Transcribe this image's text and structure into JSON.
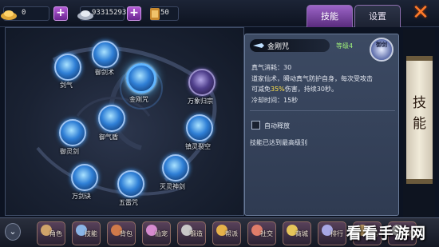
{
  "topbar": {
    "gold_value": "0",
    "silver_value": "933152938",
    "scroll_value": "50"
  },
  "tabs": [
    {
      "label": "技能",
      "active": true
    },
    {
      "label": "设置",
      "active": false
    }
  ],
  "skill_tree": {
    "nodes": [
      {
        "label": "剑气",
        "style": "blue"
      },
      {
        "label": "御剑术",
        "style": "blue"
      },
      {
        "label": "金刚咒",
        "style": "blue",
        "selected": true
      },
      {
        "label": "万象归宗",
        "style": "purple"
      },
      {
        "label": "御气盾",
        "style": "blue"
      },
      {
        "label": "御灵剑",
        "style": "blue"
      },
      {
        "label": "镇灵裂空",
        "style": "blue"
      },
      {
        "label": "灭灵神剑",
        "style": "blue"
      },
      {
        "label": "万剑诀",
        "style": "blue"
      },
      {
        "label": "五雷咒",
        "style": "blue"
      }
    ]
  },
  "skill_detail": {
    "name": "金刚咒",
    "level": "等级4",
    "portrait_label": "御剑",
    "cost": "真气消耗：30",
    "desc_1": "道家仙术，瞬动真气防护自身，每次受攻击",
    "desc_2a": "可减免",
    "desc_pct": "35%",
    "desc_2b": "伤害，持续30秒。",
    "cooldown": "冷却时间：15秒",
    "auto_release": "自动释放",
    "max_level": "技能已达到最高级别"
  },
  "side_scroll": {
    "title_line1": "技",
    "title_line2": "能"
  },
  "bottom_nav": [
    {
      "label": "角色",
      "color": "#d0a46a"
    },
    {
      "label": "技能",
      "color": "#8ab4e6"
    },
    {
      "label": "背包",
      "color": "#d07a4a"
    },
    {
      "label": "仙宠",
      "color": "#d68bcf"
    },
    {
      "label": "锻造",
      "color": "#c8c8c8"
    },
    {
      "label": "帮派",
      "color": "#e6b24a"
    },
    {
      "label": "社交",
      "color": "#e07d6a"
    },
    {
      "label": "商城",
      "color": "#e6c55a"
    },
    {
      "label": "排行",
      "color": "#a8a8e6"
    },
    {
      "label": "任务",
      "color": "#c9a56a"
    },
    {
      "label": "设置",
      "color": "#b0b0b0"
    }
  ],
  "watermark": "看看手游网"
}
